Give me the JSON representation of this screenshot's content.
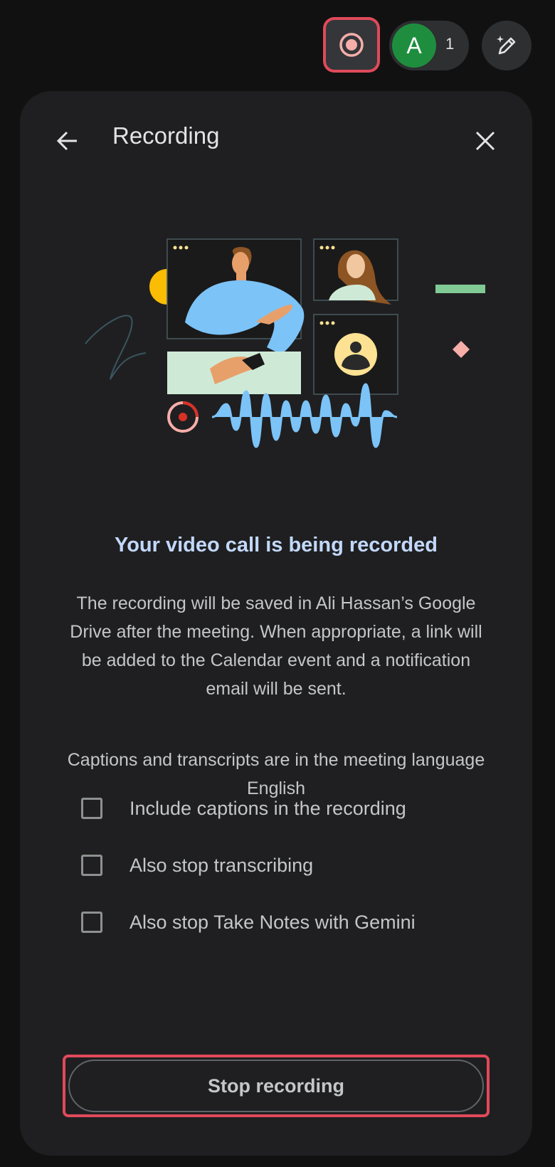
{
  "topbar": {
    "recording_indicator_icon": "record-icon",
    "participant_avatar_letter": "A",
    "participant_count": "1",
    "gemini_icon": "pen-sparkle-icon",
    "colors": {
      "record": "#f6aea9",
      "avatar": "#1e8e3e",
      "highlight": "#e04a5a"
    }
  },
  "panel": {
    "title": "Recording",
    "back_icon": "arrow-back-icon",
    "close_icon": "close-icon",
    "headline": "Your video call is being recorded",
    "description": "The recording will be saved in Ali Hassan’s Google Drive after the meeting. When appropriate, a link will be added to the Calendar event and a notification email will be sent.",
    "language_note": "Captions and transcripts are in the meeting language English",
    "options": [
      {
        "label": "Include captions in the recording",
        "checked": false
      },
      {
        "label": "Also stop transcribing",
        "checked": false
      },
      {
        "label": "Also stop Take Notes with Gemini",
        "checked": false
      }
    ],
    "stop_button_label": "Stop recording",
    "colors": {
      "headline": "#c2d8fb",
      "background": "#1f1f21"
    }
  }
}
